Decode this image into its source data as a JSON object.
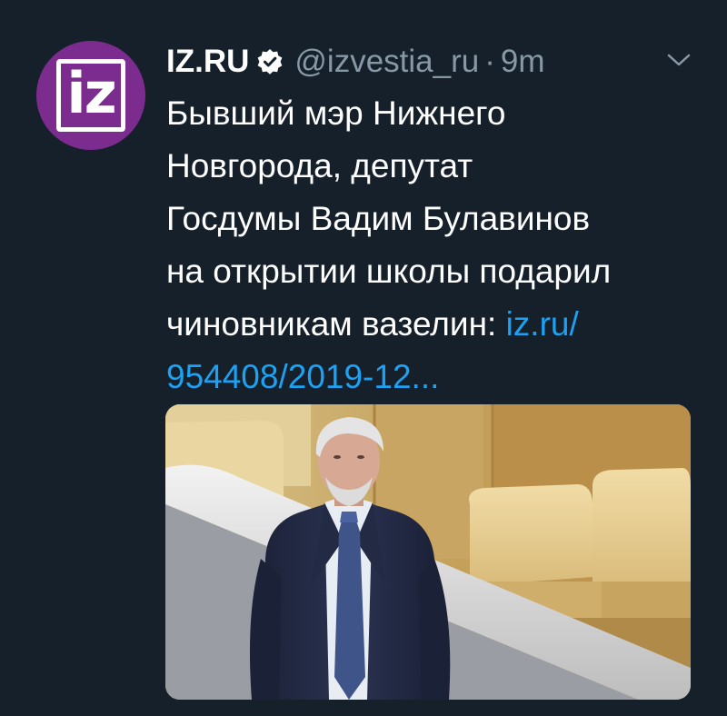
{
  "account": {
    "name": "IZ.RU",
    "handle": "@izvestia_ru",
    "separator": "·",
    "time": "9m",
    "avatar_logo": "iz",
    "avatar_color": "#7b2c8e"
  },
  "tweet": {
    "line1": "Бывший мэр Нижнего",
    "line2": "Новгорода, депутат",
    "line3": "Госдумы Вадим Булавинов",
    "line4": "на открытии школы подарил",
    "line5_text": "чиновникам вазелин: ",
    "line5_link": "iz.ru/",
    "line6_link": "954408/2019-12..."
  },
  "icons": {
    "verified": "verified-badge-icon",
    "more": "chevron-down-icon"
  },
  "colors": {
    "background": "#15202b",
    "text": "#ffffff",
    "muted": "#8899a6",
    "link": "#1da1f2"
  }
}
